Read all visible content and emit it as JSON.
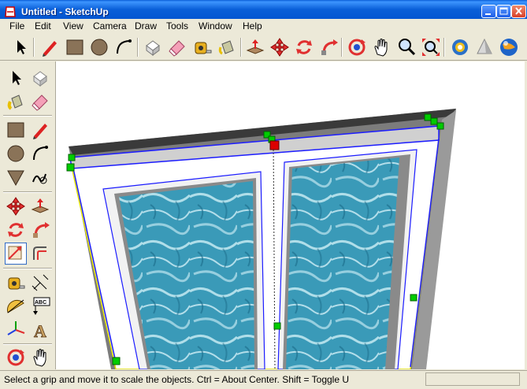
{
  "window": {
    "title": "Untitled - SketchUp",
    "minimize_icon": "minimize-icon",
    "maximize_icon": "maximize-icon",
    "close_icon": "close-icon"
  },
  "menubar": {
    "items": [
      {
        "label": "File"
      },
      {
        "label": "Edit"
      },
      {
        "label": "View"
      },
      {
        "label": "Camera"
      },
      {
        "label": "Draw"
      },
      {
        "label": "Tools"
      },
      {
        "label": "Window"
      },
      {
        "label": "Help"
      }
    ]
  },
  "toolbar": {
    "tools": [
      {
        "icon": "select-arrow-icon"
      },
      {
        "icon": "pencil-line-icon"
      },
      {
        "icon": "rectangle-icon"
      },
      {
        "icon": "circle-icon"
      },
      {
        "icon": "arc-icon"
      },
      {
        "icon": "make-component-icon"
      },
      {
        "icon": "eraser-icon"
      },
      {
        "icon": "tape-measure-icon"
      },
      {
        "icon": "paint-bucket-icon"
      },
      {
        "icon": "push-pull-icon"
      },
      {
        "icon": "move-icon"
      },
      {
        "icon": "rotate-icon"
      },
      {
        "icon": "follow-me-icon"
      },
      {
        "icon": "orbit-icon"
      },
      {
        "icon": "pan-hand-icon"
      },
      {
        "icon": "zoom-icon"
      },
      {
        "icon": "zoom-extents-icon"
      },
      {
        "icon": "get-models-icon"
      },
      {
        "icon": "share-model-icon"
      },
      {
        "icon": "google-earth-icon"
      }
    ]
  },
  "sidebar": {
    "tools": [
      {
        "icon": "select-arrow-icon"
      },
      {
        "icon": "make-component-icon"
      },
      {
        "icon": "paint-bucket-icon"
      },
      {
        "icon": "eraser-icon"
      },
      {
        "icon": "rectangle-icon"
      },
      {
        "icon": "pencil-line-icon"
      },
      {
        "icon": "circle-icon"
      },
      {
        "icon": "arc-icon"
      },
      {
        "icon": "polygon-icon"
      },
      {
        "icon": "freehand-icon"
      },
      {
        "icon": "move-icon"
      },
      {
        "icon": "push-pull-icon"
      },
      {
        "icon": "rotate-icon"
      },
      {
        "icon": "follow-me-icon"
      },
      {
        "icon": "scale-icon"
      },
      {
        "icon": "offset-icon"
      },
      {
        "icon": "tape-measure-icon"
      },
      {
        "icon": "dimension-icon"
      },
      {
        "icon": "protractor-icon"
      },
      {
        "icon": "text-label-icon"
      },
      {
        "icon": "axes-icon"
      },
      {
        "icon": "3d-text-icon"
      },
      {
        "icon": "orbit-icon"
      },
      {
        "icon": "pan-hand-icon"
      }
    ],
    "text_label_glyph": "ABC",
    "text3d_glyph": "A"
  },
  "status": {
    "text": "Select a grip and move it to scale the objects. Ctrl = About Center. Shift = Toggle U"
  },
  "colors": {
    "title_blue": "#0a5fd8",
    "chrome": "#ece9d8",
    "selection_blue": "#1c1cff",
    "grip_green": "#00cc00",
    "grip_red": "#dd0000",
    "water": "#3a9ab8"
  }
}
